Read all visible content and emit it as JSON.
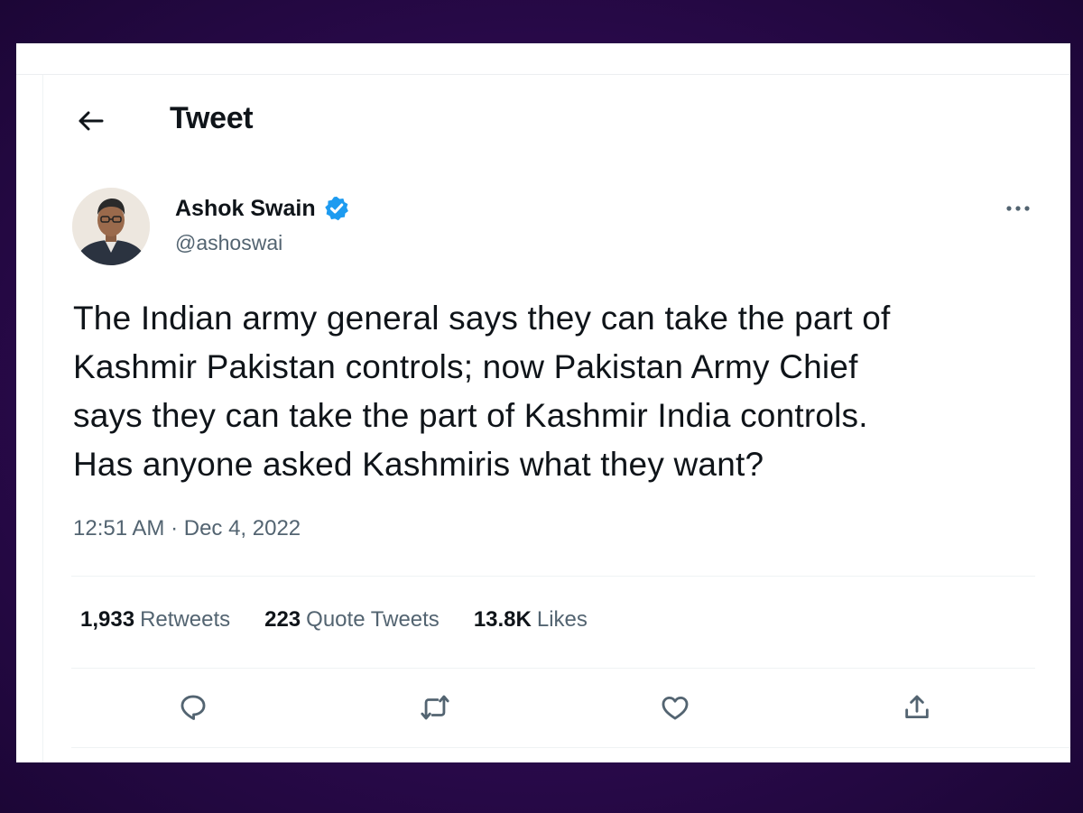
{
  "header": {
    "title": "Tweet",
    "back_icon": "arrow-left-icon"
  },
  "author": {
    "name": "Ashok Swain",
    "handle": "@ashoswai",
    "verified": true,
    "verified_color": "#1d9bf0"
  },
  "tweet": {
    "lines": [
      "The Indian army general says they can take the part of",
      "Kashmir Pakistan controls; now Pakistan Army Chief",
      "says they can take the part of Kashmir India controls.",
      "Has anyone asked Kashmiris what they want?"
    ],
    "timestamp": "12:51 AM · Dec 4, 2022"
  },
  "stats": {
    "retweets_count": "1,933",
    "retweets_label": "Retweets",
    "quotes_count": "223",
    "quotes_label": "Quote Tweets",
    "likes_count": "13.8K",
    "likes_label": "Likes"
  },
  "actions": [
    {
      "icon": "reply-icon"
    },
    {
      "icon": "retweet-icon"
    },
    {
      "icon": "like-icon"
    },
    {
      "icon": "share-icon"
    }
  ],
  "colors": {
    "background": "#2e0b52",
    "card": "#ffffff",
    "text_primary": "#0f1419",
    "text_secondary": "#536471",
    "accent": "#1d9bf0"
  }
}
